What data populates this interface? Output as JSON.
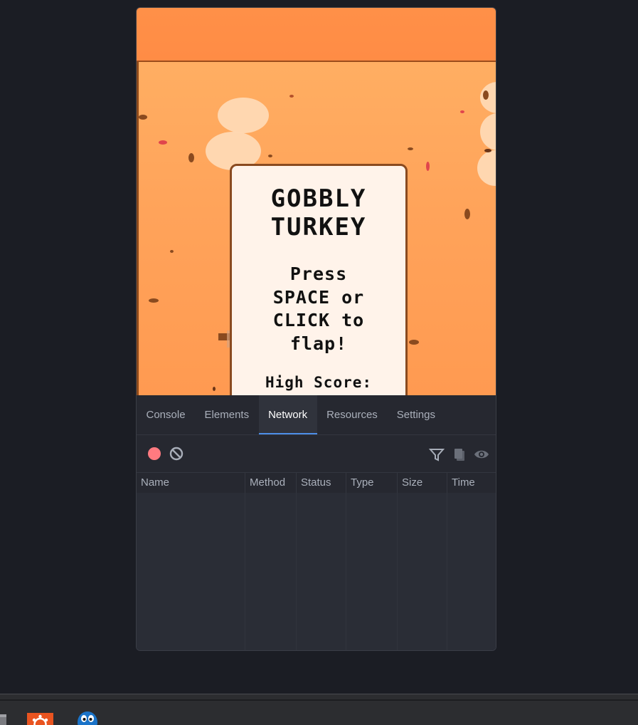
{
  "game": {
    "title_line1": "GOBBLY",
    "title_line2": "TURKEY",
    "instructions": [
      "Press",
      "SPACE or",
      "CLICK to",
      "flap!"
    ],
    "high_score_label": "High Score:"
  },
  "devtools": {
    "tabs": [
      {
        "label": "Console"
      },
      {
        "label": "Elements"
      },
      {
        "label": "Network"
      },
      {
        "label": "Resources"
      },
      {
        "label": "Settings"
      }
    ],
    "active_tab": "Network",
    "columns": [
      "Name",
      "Method",
      "Status",
      "Type",
      "Size",
      "Time"
    ]
  },
  "colors": {
    "accent": "#4d8ee8",
    "record": "#ff7a80",
    "game_sky": "#ffa35a",
    "panel_bg": "#fff3ea"
  },
  "taskbar": {
    "icons": [
      "window-icon",
      "ubuntu-icon",
      "penguin-icon"
    ]
  }
}
